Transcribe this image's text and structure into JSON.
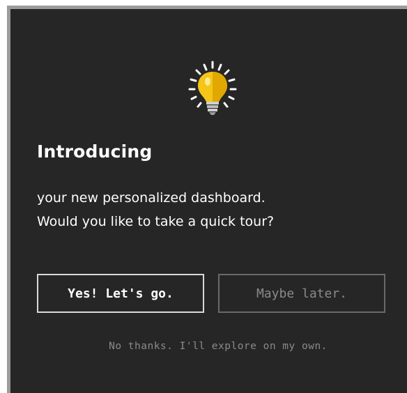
{
  "dialog": {
    "title": "Introducing",
    "body_lines": [
      "your new personalized dashboard.",
      "Would you like to take a quick tour?"
    ],
    "primary_button": "Yes! Let's go.",
    "secondary_button": "Maybe later.",
    "dismiss_link": "No thanks. I'll explore on my own.",
    "icon": "lightbulb-icon"
  },
  "colors": {
    "background": "#262626",
    "frame_border": "#9b9b9b",
    "bulb_yellow": "#f5c518",
    "text_primary": "#ffffff",
    "text_muted": "#8a8a8a"
  }
}
